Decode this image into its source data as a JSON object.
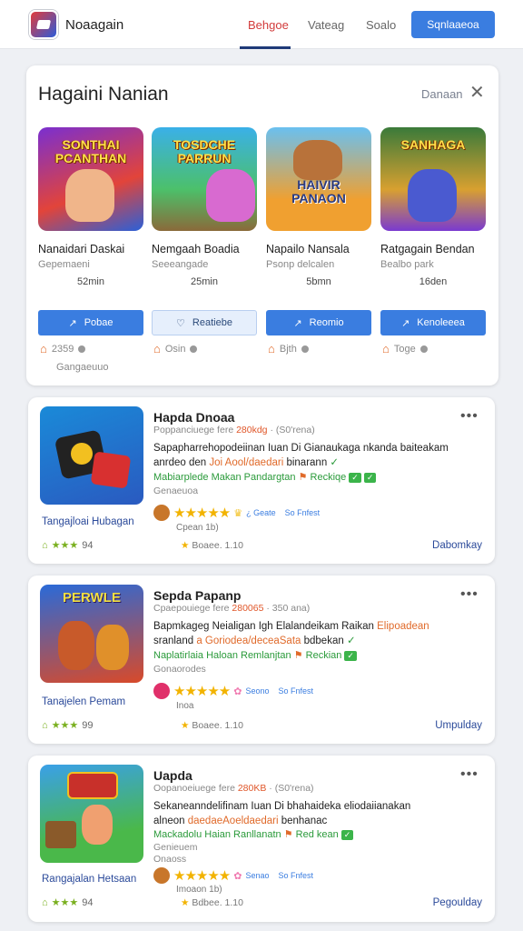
{
  "header": {
    "app_name": "Noaagain",
    "nav": [
      "Behgoe",
      "Vateag",
      "Soalo"
    ],
    "nav_active_index": 0,
    "button": "Sqnlaaeoa"
  },
  "hero": {
    "title": "Hagaini Nanian",
    "link": "Danaan",
    "footer": "Gangaeuuo",
    "tiles": [
      {
        "art": "SONTHAI PCANTHAN",
        "name": "Nanaidari Daskai",
        "sub": "Gepemaeni",
        "dur": "52min",
        "btn": "Pobae",
        "stat": "2359"
      },
      {
        "art": "TOSDCHE PARRUN",
        "name": "Nemgaah Boadia",
        "sub": "Seeeangade",
        "dur": "25min",
        "btn": "Reatiebe",
        "stat": "Osin"
      },
      {
        "art": "HAIVIR PANAON",
        "name": "Napailo Nansala",
        "sub": "Psonp delcalen",
        "dur": "5bmn",
        "btn": "Reomio",
        "stat": "Bjth"
      },
      {
        "art": "SANHAGA",
        "name": "Ratgagain Bendan",
        "sub": "Bealbo park",
        "dur": "16den",
        "btn": "Kenoleeea",
        "stat": "Toge"
      }
    ]
  },
  "list": [
    {
      "title": "Hapda Dnoaa",
      "meta_a": "Poppanciuege fere",
      "meta_hl": "280kdg",
      "meta_b": "· (S0'rena)",
      "desc_a": "Sapapharrehopodeiinan Iuan Di Gianaukaga nkanda baiteakam",
      "desc_b": "anrdeo den",
      "desc_hl": "Joi Aool/daedari",
      "desc_c": "binarann",
      "tag": "Mabiarplede Makan Pandargtan",
      "tag_b": "Reckiqe",
      "cat": "Genaeuoa",
      "rate_extra": "¿ Geate",
      "rate_sb": "So Fnfest",
      "small": "Cpean 1b)",
      "name": "Tangajloai Hubagan",
      "stat": "94",
      "score": "Boaee. 1.10",
      "link": "Dabomkay"
    },
    {
      "title": "Sepda Papanp",
      "meta_a": "Cpaepouiege fere",
      "meta_hl": "280065",
      "meta_b": "· 350 ana)",
      "desc_a": "Bapmkageg Neialigan Igh Elalandeikam Raikan",
      "desc_hl0": "Elipoadean",
      "desc_b": "sranland",
      "desc_hl": "a Goriodea/deceaSata",
      "desc_c": "bdbekan",
      "tag": "Naplatirlaia Haloan Remlanjtan",
      "tag_b": "Reckian",
      "cat": "Gonaorodes",
      "rate_extra": "Seono",
      "rate_sb": "So Fnfest",
      "small": "Inoa",
      "name": "Tanajelen Pemam",
      "stat": "99",
      "score": "Boaee. 1.10",
      "link": "Umpulday"
    },
    {
      "title": "Uapda",
      "meta_a": "Oopanoeiuege fere",
      "meta_hl": "280KB",
      "meta_b": "· (S0'rena)",
      "desc_a": "Sekaneanndelifinam Iuan Di bhahaideka eliodaiianakan",
      "desc_b": "alneon",
      "desc_hl": "daedaeAoeldaedari",
      "desc_c": "benhanac",
      "tag": "Mackadolu Haian Ranllanatn",
      "tag_b": "Red kean",
      "cat": "Genieuem",
      "cat2": "Onaoss",
      "rate_extra": "Senao",
      "rate_sb": "So Fnfest",
      "small": "Imoaon 1b)",
      "name": "Rangajalan Hetsaan",
      "stat": "94",
      "score": "Bdbee. 1.10",
      "link": "Pegoulday"
    }
  ]
}
